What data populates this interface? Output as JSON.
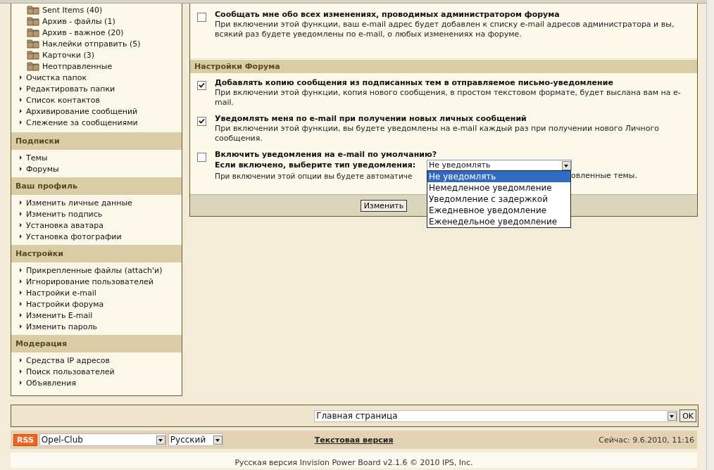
{
  "sidebar": {
    "folders": [
      "Sent Items (40)",
      "Архив - файлы (1)",
      "Архив - важное (20)",
      "Наклейки отправить (5)",
      "Карточки (3)",
      "Неотправленные"
    ],
    "links": [
      "Очистка папок",
      "Редактировать папки",
      "Список контактов",
      "Архивирование сообщений",
      "Слежение за сообщениями"
    ],
    "sections": [
      {
        "title": "Подписки",
        "items": [
          "Темы",
          "Форумы"
        ]
      },
      {
        "title": "Ваш профиль",
        "items": [
          "Изменить личные данные",
          "Изменить подпись",
          "Установка аватара",
          "Установка фотографии"
        ]
      },
      {
        "title": "Настройки",
        "items": [
          "Прикрепленные файлы (attach'и)",
          "Игнорирование пользователей",
          "Настройки e-mail",
          "Настройки форума",
          "Изменить E-mail",
          "Изменить пароль"
        ]
      },
      {
        "title": "Модерация",
        "items": [
          "Средства IP адресов",
          "Поиск пользователей",
          "Объявления"
        ]
      }
    ]
  },
  "top_option": {
    "checked": false,
    "title": "Сообщать мне обо всех изменениях, проводимых администратором форума",
    "description": "При включении этой функции, ваш e-mail адрес будет добавлен к списку e-mail адресов администратора и вы, всякий раз будете уведомлены по e-mail, о любых изменениях на форуме."
  },
  "forum_settings": {
    "title": "Настройки Форума",
    "options": [
      {
        "checked": true,
        "title": "Добавлять копию сообщения из подписанных тем в отправляемое письмо-уведомление",
        "description": "При включении этой функции, копия нового сообщения, в простом текстовом формате, будет выслана вам на e-mail."
      },
      {
        "checked": true,
        "title": "Уведомлять меня по e-mail при получении новых личных сообщений",
        "description": "При включении этой функции, вы будете уведомлены на e-mail каждый раз при получении нового Личного сообщения."
      }
    ],
    "default_option": {
      "checked": false,
      "title": "Включить уведомления на e-mail по умолчанию?",
      "select_label": "Если включено, выберите тип уведомления:",
      "select_value": "Не уведомлять",
      "dropdown": [
        {
          "label": "Не уведомлять",
          "selected": true
        },
        {
          "label": "Немедленное уведомление",
          "selected": false
        },
        {
          "label": "Уведомление с задержкой",
          "selected": false
        },
        {
          "label": "Ежедневное уведомление",
          "selected": false
        },
        {
          "label": "Еженедельное уведомление",
          "selected": false
        }
      ],
      "description_start": "При включении этой опции вы будете автоматиче",
      "description_end": "овленные темы."
    },
    "submit": "Изменить"
  },
  "jump": {
    "value": "Главная страница",
    "button": "OK"
  },
  "footer": {
    "rss": "RSS",
    "skin": "Opel-Club",
    "language": "Русский",
    "text_version": "Текстовая версия",
    "time": "Сейчас: 9.6.2010, 11:16"
  },
  "copyright": "Русская версия Invision Power Board v2.1.6 © 2010  IPS, Inc."
}
